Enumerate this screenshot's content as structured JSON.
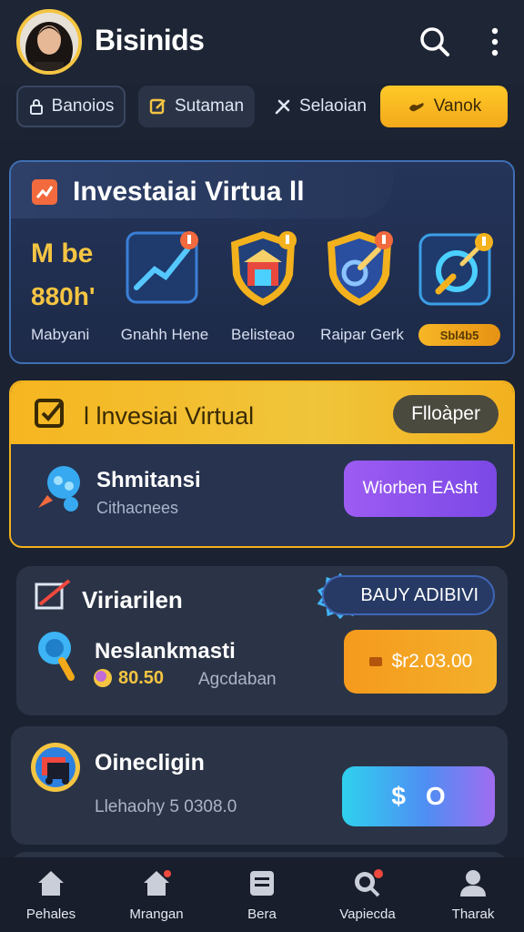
{
  "header": {
    "app_title": "Bisinids",
    "icons": [
      "avatar",
      "search-icon",
      "more-vert-icon"
    ]
  },
  "tabs": [
    {
      "label": "Banoios",
      "icon": "lock-icon"
    },
    {
      "label": "Sutaman",
      "icon": "edit-icon"
    },
    {
      "label": "Selaoian",
      "icon": "tools-icon"
    },
    {
      "label": "Vanok",
      "icon": "hand-icon",
      "active": true
    }
  ],
  "card1": {
    "title": "Investaiai Virtua ll",
    "stat_top": "M be",
    "stat_bottom": "880h'",
    "stat_label": "Mabyani",
    "features": [
      {
        "label": "Gnahh Hene",
        "icon": "chart-up-icon"
      },
      {
        "label": "Belisteao",
        "icon": "bank-shield-icon"
      },
      {
        "label": "Raipar Gerk",
        "icon": "shield-key-icon"
      },
      {
        "label": "",
        "icon": "search-target-icon",
        "badge": "Sbl4b5"
      }
    ]
  },
  "card2": {
    "title": "l lnvesiai Virtual",
    "pill": "Flloàper",
    "name": "Shmitansi",
    "sub": "Cithacnees",
    "button": "Wiorben EAsht"
  },
  "card3": {
    "title": "Viriarilen",
    "pill": "BAUY ADIBIVI",
    "name": "Neslankmasti",
    "amount": "80.50",
    "sub": "Agcdaban",
    "button": "$r2.03.00"
  },
  "card4": {
    "title": "Oinecligin",
    "sub": "Llehaohy 5 0308.0",
    "button_left": "$",
    "button_right": "O"
  },
  "nav": [
    {
      "label": "Pehales",
      "icon": "home-icon"
    },
    {
      "label": "Mrangan",
      "icon": "home-alert-icon"
    },
    {
      "label": "Bera",
      "icon": "list-icon"
    },
    {
      "label": "Vapiecda",
      "icon": "search-alert-icon"
    },
    {
      "label": "Tharak",
      "icon": "person-icon"
    }
  ],
  "colors": {
    "background": "#1b2232",
    "accent_yellow": "#f5c542",
    "active_tab": "#ffc928",
    "purple_button": "#9d5cf2",
    "orange_button": "#f59a1d",
    "teal_button": "#2fd1ee"
  }
}
